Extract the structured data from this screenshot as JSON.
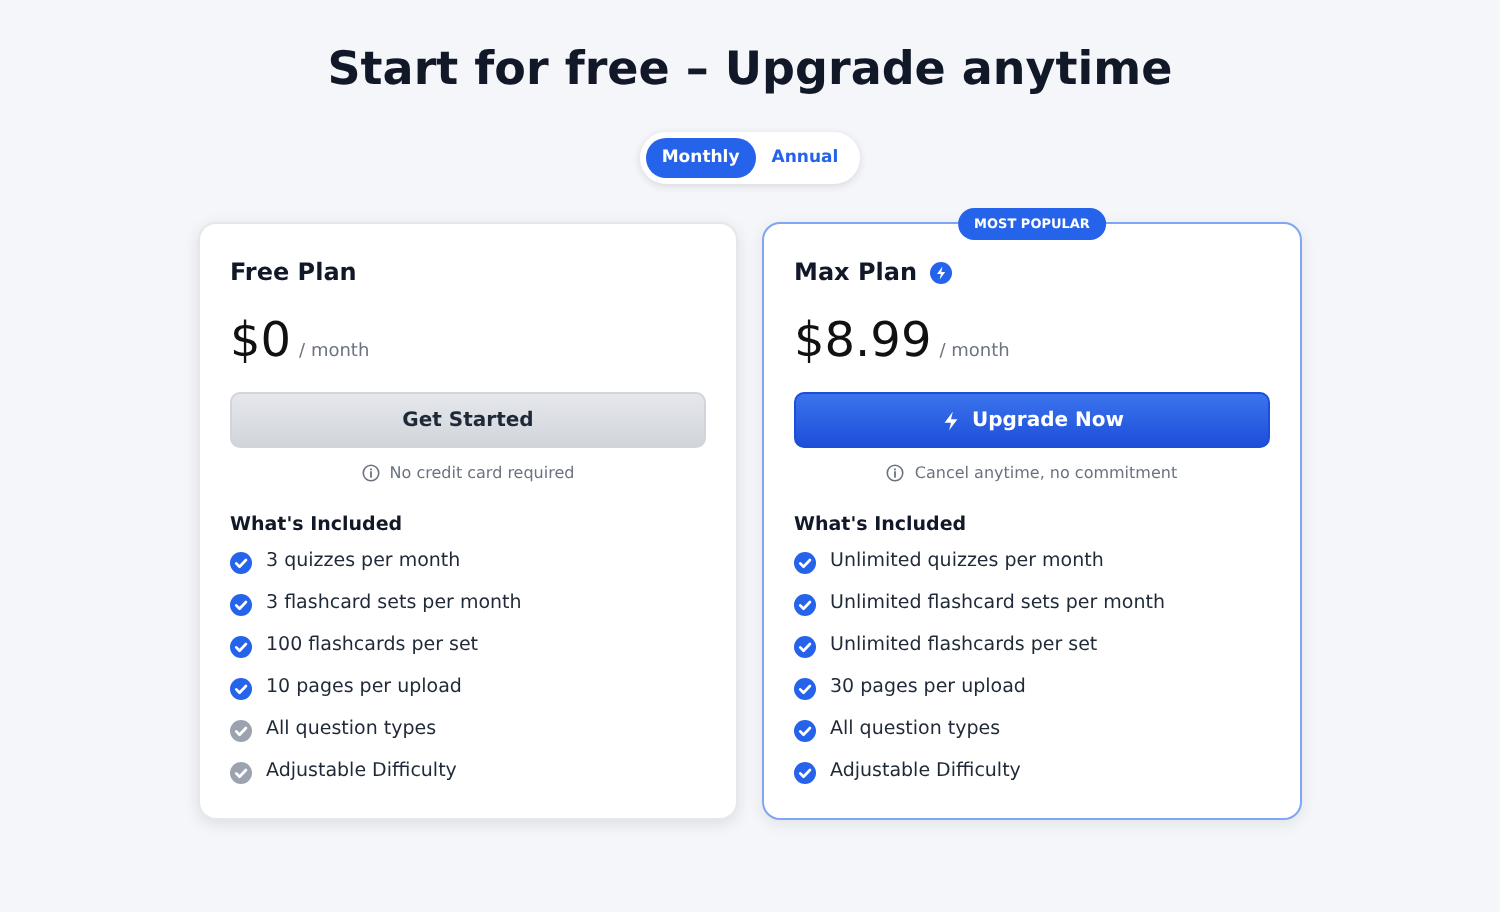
{
  "title": "Start for free – Upgrade anytime",
  "billing_toggle": [
    {
      "label": "Monthly",
      "selected": true
    },
    {
      "label": "Annual",
      "selected": false
    }
  ],
  "plans": [
    {
      "name": "Free Plan",
      "featured": false,
      "price": "$0",
      "period": "/ month",
      "button": {
        "label": "Get Started",
        "kind": "secondary"
      },
      "note": "No credit card required",
      "features_heading": "What's Included",
      "features": [
        {
          "text": "3 quizzes per month",
          "included": true
        },
        {
          "text": "3 flashcard sets per month",
          "included": true
        },
        {
          "text": "100 flashcards per set",
          "included": true
        },
        {
          "text": "10 pages per upload",
          "included": true
        },
        {
          "text": "All question types",
          "included": false
        },
        {
          "text": "Adjustable Difficulty",
          "included": false
        }
      ]
    },
    {
      "name": "Max Plan",
      "featured": true,
      "badge": "MOST POPULAR",
      "price": "$8.99",
      "period": "/ month",
      "button": {
        "label": "Upgrade Now",
        "kind": "primary"
      },
      "note": "Cancel anytime, no commitment",
      "features_heading": "What's Included",
      "features": [
        {
          "text": "Unlimited quizzes per month",
          "included": true
        },
        {
          "text": "Unlimited flashcard sets per month",
          "included": true
        },
        {
          "text": "Unlimited flashcards per set",
          "included": true
        },
        {
          "text": "30 pages per upload",
          "included": true
        },
        {
          "text": "All question types",
          "included": true
        },
        {
          "text": "Adjustable Difficulty",
          "included": true
        }
      ]
    }
  ]
}
